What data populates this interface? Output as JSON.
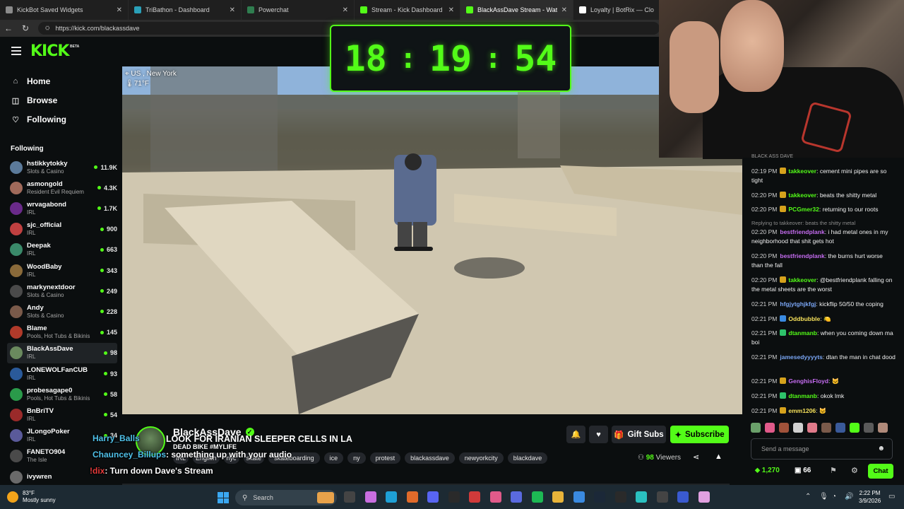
{
  "browser": {
    "tabs": [
      {
        "title": "KickBot Saved Widgets",
        "color": "#8b8b8b",
        "active": false
      },
      {
        "title": "TriBathon - Dashboard",
        "color": "#2aa0b8",
        "active": false
      },
      {
        "title": "Powerchat",
        "color": "#2f7d4f",
        "active": false
      },
      {
        "title": "Stream - Kick Dashboard",
        "color": "#53fc18",
        "active": false
      },
      {
        "title": "BlackAssDave Stream - Watch",
        "color": "#53fc18",
        "active": true
      },
      {
        "title": "Loyalty | BotRix — Cloud",
        "color": "#ffffff",
        "active": false
      }
    ],
    "url": "https://kick.com/blackassdave"
  },
  "timer": {
    "h": "18",
    "m": "19",
    "s": "54",
    "sep": ":"
  },
  "kick": {
    "logo": "KICK",
    "beta": "BETA"
  },
  "nav": [
    {
      "label": "Home",
      "icon": "home-icon",
      "glyph": "⌂"
    },
    {
      "label": "Browse",
      "icon": "browse-icon",
      "glyph": "◫"
    },
    {
      "label": "Following",
      "icon": "heart-icon",
      "glyph": "♡"
    }
  ],
  "following": {
    "heading": "Following",
    "channels": [
      {
        "name": "hstikkytokky",
        "category": "Slots & Casino",
        "viewers": "11.9K",
        "color": "#5b7a9a"
      },
      {
        "name": "asmongold",
        "category": "Resident Evil Requiem",
        "viewers": "4.3K",
        "color": "#a06a5a"
      },
      {
        "name": "wrvagabond",
        "category": "IRL",
        "viewers": "1.7K",
        "color": "#6a2a8a"
      },
      {
        "name": "sjc_official",
        "category": "IRL",
        "viewers": "900",
        "color": "#c04040"
      },
      {
        "name": "Deepak",
        "category": "IRL",
        "viewers": "663",
        "color": "#3a8a6a"
      },
      {
        "name": "WoodBaby",
        "category": "IRL",
        "viewers": "343",
        "color": "#8a6a3a"
      },
      {
        "name": "markynextdoor",
        "category": "Slots & Casino",
        "viewers": "249",
        "color": "#4a4a4a"
      },
      {
        "name": "Andy",
        "category": "Slots & Casino",
        "viewers": "228",
        "color": "#7a5a4a"
      },
      {
        "name": "Blame",
        "category": "Pools, Hot Tubs & Bikinis",
        "viewers": "145",
        "color": "#b03a2a"
      },
      {
        "name": "BlackAssDave",
        "category": "IRL",
        "viewers": "98",
        "color": "#6a8a5e"
      },
      {
        "name": "LONEWOLFanCUB",
        "category": "IRL",
        "viewers": "93",
        "color": "#2a5a9a"
      },
      {
        "name": "probesagape0",
        "category": "Pools, Hot Tubs & Bikinis",
        "viewers": "58",
        "color": "#2a9a4a"
      },
      {
        "name": "BnBriTV",
        "category": "IRL",
        "viewers": "54",
        "color": "#9a2a2a"
      },
      {
        "name": "JLongoPoker",
        "category": "IRL",
        "viewers": "34",
        "color": "#5a5a9a"
      },
      {
        "name": "FANETO904",
        "category": "The Isle",
        "viewers": "",
        "color": "#4a4a4a"
      },
      {
        "name": "ivywren",
        "category": "",
        "viewers": "",
        "color": "#6a6a6a"
      }
    ]
  },
  "video": {
    "location": "US , New York",
    "temp": "71°F"
  },
  "stream": {
    "streamer": "BlackAssDave",
    "title": "LOOK FOR IRANIAN SLEEPER CELLS IN LA",
    "subtitle": "DEAD BIKE #MYLIFE",
    "tags": [
      "IRL",
      "English",
      "nyc",
      "skate",
      "skateboarding",
      "ice",
      "ny",
      "protest",
      "blackassdave",
      "newyorkcity",
      "blackdave"
    ],
    "viewers": "98",
    "viewers_label": "Viewers",
    "gift_label": "Gift Subs",
    "subscribe_label": "Subscribe"
  },
  "overlay_chat": [
    {
      "user": "Harry_Balls",
      "text": "",
      "color": "#4fc0e8"
    },
    {
      "user": "Chauncey_Billups",
      "text": ": something up with your audio",
      "color": "#4fc0e8"
    },
    {
      "user": "!dix",
      "text": ": Turn down Dave's Stream",
      "color": "#e83a3a"
    }
  ],
  "chat": {
    "header": "BLACK ASS DAVE",
    "messages": [
      {
        "time": "02:19 PM",
        "user": "takkeover",
        "ucolor": "#53fc18",
        "badge": "#d6a21c",
        "text": ": cement mini pipes are so tight"
      },
      {
        "time": "02:20 PM",
        "user": "takkeover",
        "ucolor": "#53fc18",
        "badge": "#d6a21c",
        "text": ": beats the shitty metal"
      },
      {
        "time": "02:20 PM",
        "user": "PCGmer32",
        "ucolor": "#53fc18",
        "badge": "#d6a21c",
        "text": ": returning to our roots"
      },
      {
        "reply": "Replying to takkeover: beats the shitty metal"
      },
      {
        "time": "02:20 PM",
        "user": "bestfriendplank",
        "ucolor": "#c56cf0",
        "badge": "",
        "text": ": i had metal ones in my neighborhood that shit gets hot"
      },
      {
        "time": "02:20 PM",
        "user": "bestfriendplank",
        "ucolor": "#c56cf0",
        "badge": "",
        "text": ": the burns hurt worse than the fall"
      },
      {
        "time": "02:20 PM",
        "user": "takkeover",
        "ucolor": "#53fc18",
        "badge": "#d6a21c",
        "text": ": @bestfriendplank falling on the metal sheets are the worst"
      },
      {
        "time": "02:21 PM",
        "user": "hfgjytghjkfgj",
        "ucolor": "#7aa6f5",
        "badge": "",
        "text": ": kickflip 50/50 the coping"
      },
      {
        "time": "02:21 PM",
        "user": "Oddbubble",
        "ucolor": "#f5e05a",
        "badge": "#3a8ae0",
        "text": ": 🍋"
      },
      {
        "time": "02:21 PM",
        "user": "dtanmanb",
        "ucolor": "#53fc18",
        "badge": "#2ec26a",
        "text": ": when you coming down ma boi"
      },
      {
        "time": "02:21 PM",
        "user": "jamesedyyyyts",
        "ucolor": "#7aa6f5",
        "badge": "",
        "text": ": dtan the man in chat dood"
      },
      {
        "time": "02:21 PM",
        "user": "GenghisFloyd",
        "ucolor": "#c56cf0",
        "badge": "#d6a21c",
        "text": ": 🐱"
      },
      {
        "time": "02:21 PM",
        "user": "dtanmanb",
        "ucolor": "#53fc18",
        "badge": "#2ec26a",
        "text": ": okok lmk"
      },
      {
        "time": "02:21 PM",
        "user": "emm1206",
        "ucolor": "#f5e05a",
        "badge": "#d6a21c",
        "text": ": 🐱"
      }
    ],
    "input_placeholder": "Send a message",
    "points": "1,270",
    "points2": "66",
    "chat_button": "Chat"
  },
  "taskbar": {
    "weather_temp": "83°F",
    "weather_desc": "Mostly sunny",
    "search_label": "Search",
    "time": "2:22 PM",
    "date": "3/9/2026"
  }
}
